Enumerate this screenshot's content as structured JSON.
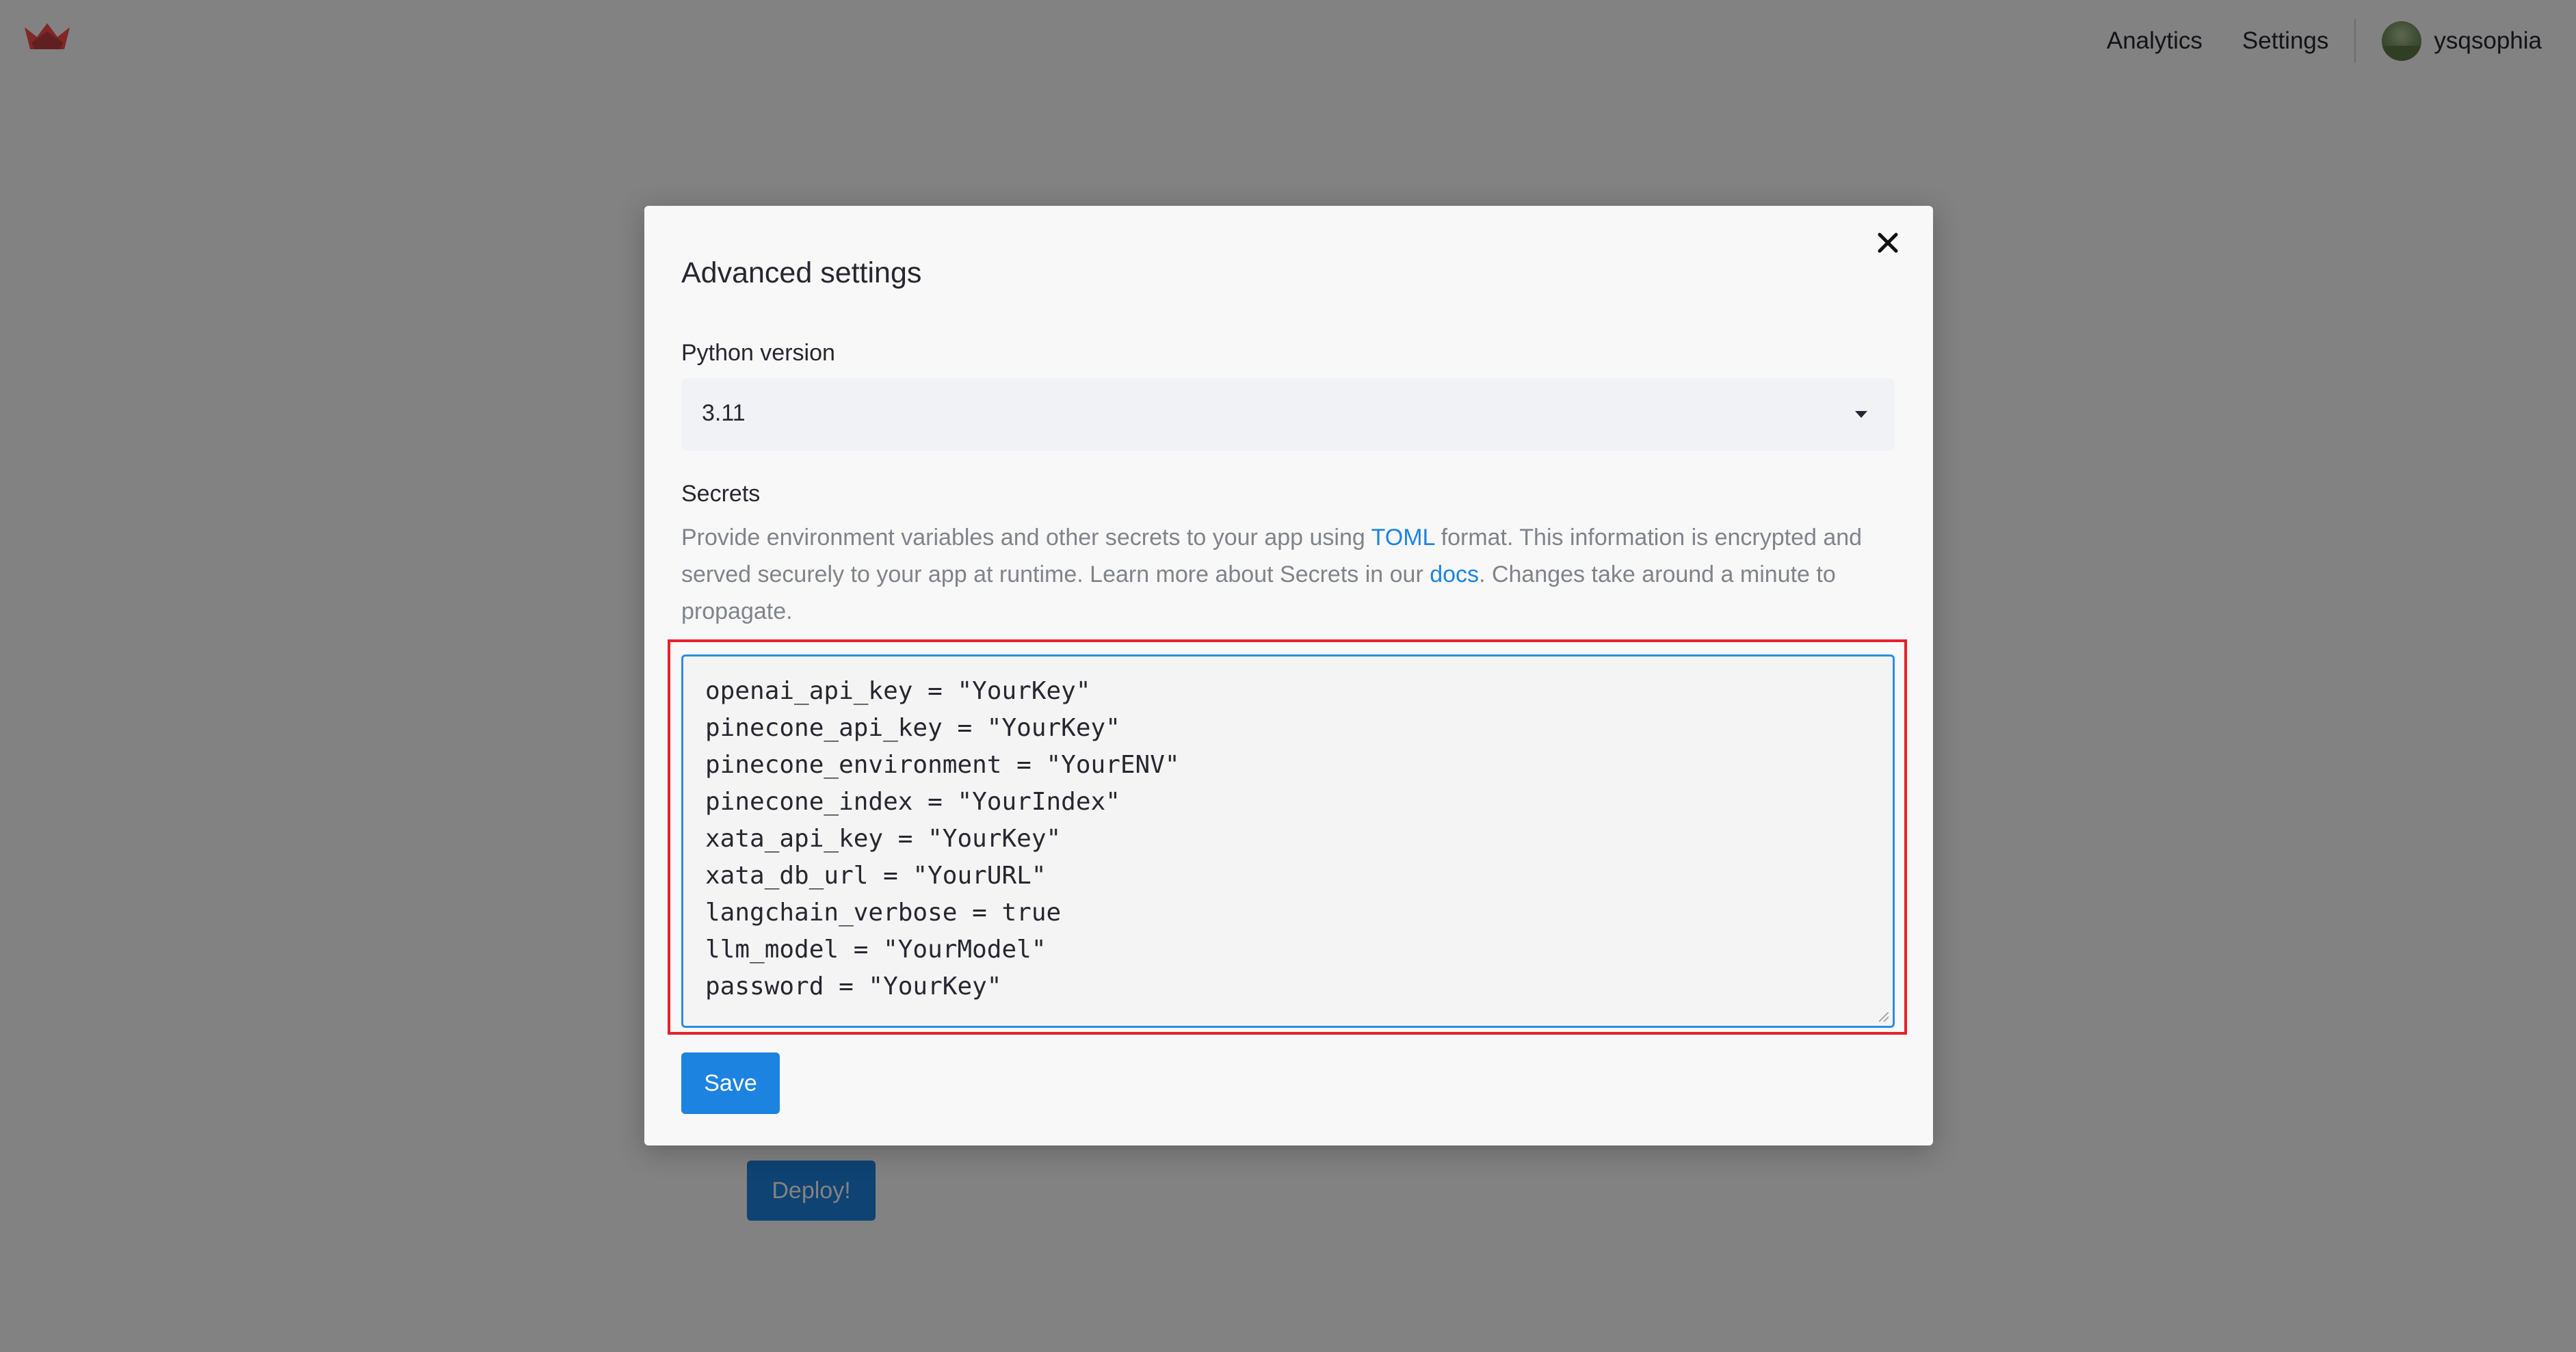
{
  "colors": {
    "accent": "#1c83e1",
    "highlight_border": "#e8202a",
    "logo": "#ff4b4b"
  },
  "header": {
    "logo_icon": "streamlit-crown-icon",
    "nav": [
      {
        "label": "Analytics"
      },
      {
        "label": "Settings"
      }
    ],
    "user": {
      "avatar_icon": "avatar-icon",
      "name": "ysqsophia"
    }
  },
  "background_page": {
    "deploy_label": "Deploy!"
  },
  "modal": {
    "title": "Advanced settings",
    "close_icon": "close-icon",
    "python_version": {
      "label": "Python version",
      "value": "3.11",
      "caret_icon": "caret-down-icon"
    },
    "secrets": {
      "label": "Secrets",
      "help_part1": "Provide environment variables and other secrets to your app using ",
      "help_link1": "TOML",
      "help_part2": " format. This information is encrypted and served securely to your app at runtime. Learn more about Secrets in our ",
      "help_link2": "docs",
      "help_part3": ". Changes take around a minute to propagate.",
      "lines": [
        "openai_api_key = \"YourKey\"",
        "pinecone_api_key = \"YourKey\"",
        "pinecone_environment = \"YourENV\"",
        "pinecone_index = \"YourIndex\"",
        "xata_api_key = \"YourKey\"",
        "xata_db_url = \"YourURL\"",
        "langchain_verbose = true",
        "llm_model = \"YourModel\"",
        "password = \"YourKey\""
      ]
    },
    "save_label": "Save"
  }
}
